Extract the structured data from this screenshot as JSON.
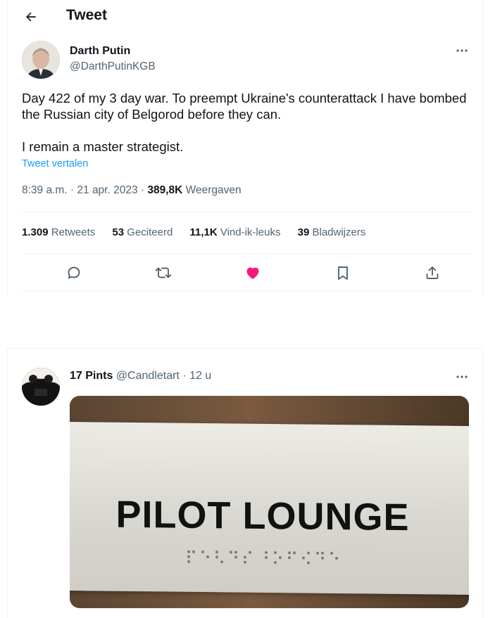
{
  "header": {
    "title": "Tweet",
    "back_icon": "arrow-left-icon"
  },
  "tweet": {
    "author_name": "Darth Putin",
    "author_handle": "@DarthPutinKGB",
    "text_line1": "Day 422 of my 3 day war. To preempt Ukraine's counterattack I have bombed the Russian city of Belgorod before they can.",
    "text_line2": "I remain a master strategist.",
    "translate_link": "Tweet vertalen",
    "time_date": "8:39 a.m. · 21 apr. 2023 · ",
    "views_count": "389,8K",
    "views_label": " Weergaven",
    "stats": {
      "retweets_count": "1.309",
      "retweets_label": " Retweets",
      "quotes_count": "53",
      "quotes_label": " Geciteerd",
      "likes_count": "11,1K",
      "likes_label": " Vind-ik-leuks",
      "bookmarks_count": "39",
      "bookmarks_label": " Bladwijzers"
    },
    "actions": [
      "reply-icon",
      "retweet-icon",
      "like-icon",
      "bookmark-icon",
      "share-icon"
    ],
    "colors": {
      "like": "#f91880",
      "link": "#1d9bf0",
      "muted": "#536471"
    }
  },
  "reply": {
    "author_name": "17 Pints",
    "author_handle": "@Candletart",
    "time": " · 12 u",
    "image_text": "PILOT LOUNGE"
  }
}
